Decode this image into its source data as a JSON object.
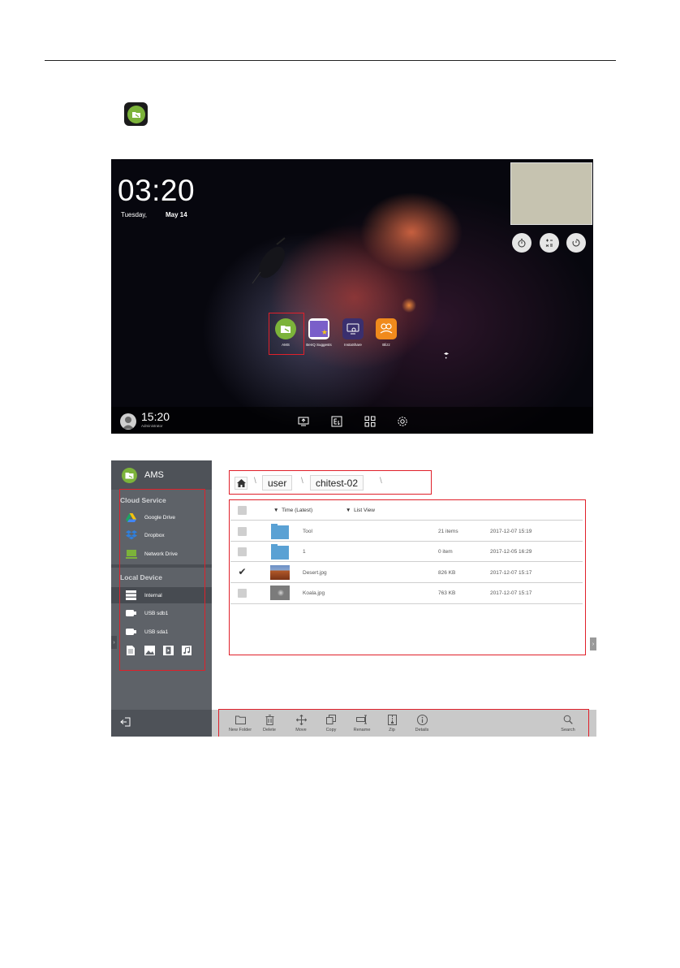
{
  "home": {
    "clock": "03:20",
    "day": "Tuesday,",
    "date": "May 14",
    "apps": [
      {
        "label": "AMS",
        "color": "#7cb33a"
      },
      {
        "label": "BenQ Suggests",
        "color": "#7a5fc9"
      },
      {
        "label": "InstaShare",
        "color": "#3a2f6e"
      },
      {
        "label": "Blizz",
        "color": "#f08a1c"
      }
    ],
    "taskbar": {
      "time": "15:20",
      "user": "Administrator"
    }
  },
  "ams": {
    "title": "AMS",
    "cloud_section": "Cloud Service",
    "cloud_items": [
      "Google Drive",
      "Dropbox",
      "Network Drive"
    ],
    "local_section": "Local Device",
    "local_items": [
      "Internal",
      "USB sdb1",
      "USB sda1"
    ],
    "breadcrumb": [
      "user",
      "chitest-02"
    ],
    "sort_label": "Time (Latest)",
    "view_label": "List View",
    "files": [
      {
        "name": "Tool",
        "size": "21 items",
        "date": "2017-12-07  15:19",
        "type": "folder",
        "checked": false
      },
      {
        "name": "1",
        "size": "0 item",
        "date": "2017-12-05  16:29",
        "type": "folder",
        "checked": false
      },
      {
        "name": "Desert.jpg",
        "size": "826 KB",
        "date": "2017-12-07  15:17",
        "type": "image",
        "checked": true
      },
      {
        "name": "Koala.jpg",
        "size": "763 KB",
        "date": "2017-12-07  15:17",
        "type": "image",
        "checked": false
      }
    ],
    "toolbar": [
      "New Folder",
      "Delete",
      "Move",
      "Copy",
      "Rename",
      "Zip",
      "Details",
      "Search"
    ]
  },
  "colors": {
    "highlight": "#e0202a",
    "accent": "#7cb33a",
    "folder": "#5aa1d4",
    "sidebar": "#5e6268"
  }
}
